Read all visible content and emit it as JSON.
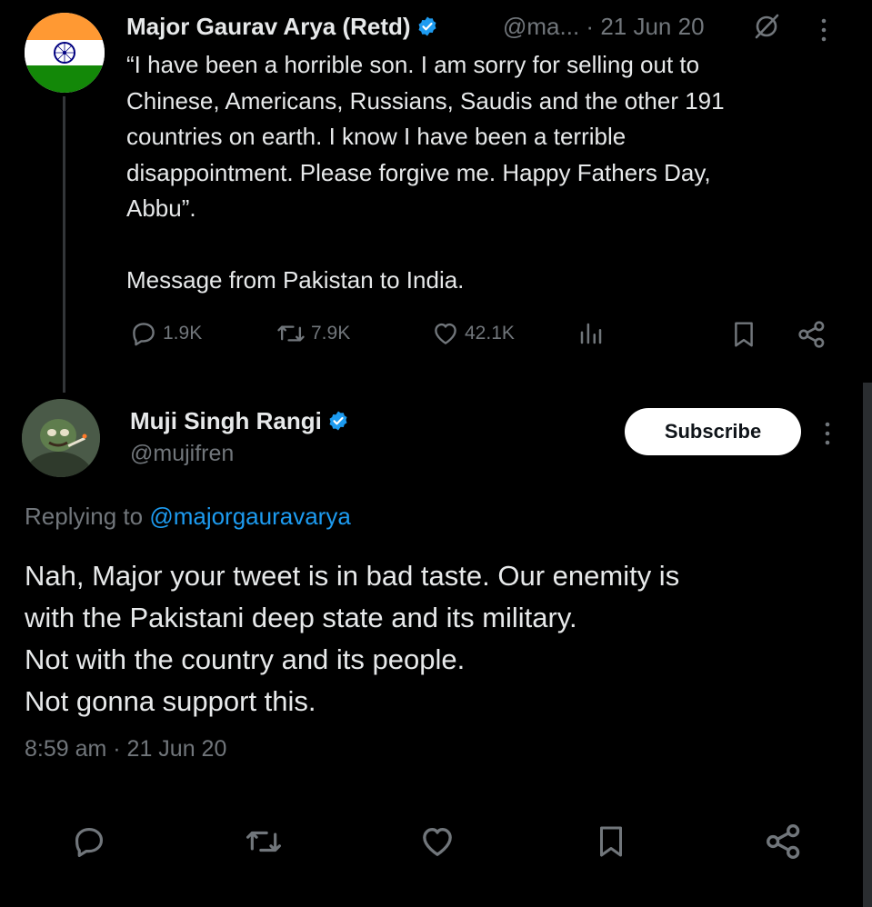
{
  "tweet1": {
    "author_name": "Major Gaurav Arya (Retd)",
    "handle_truncated": "@ma...",
    "separator": "·",
    "date": "21 Jun 20",
    "text": "“I have been a horrible son. I am sorry for selling out to\nChinese, Americans, Russians, Saudis and the other 191\ncountries on earth. I know I have been a terrible\ndisappointment. Please forgive me. Happy Fathers Day,\nAbbu”.\n\nMessage from Pakistan to India.",
    "replies": "1.9K",
    "retweets": "7.9K",
    "likes": "42.1K",
    "avatar_icon": "india-flag-icon"
  },
  "tweet2": {
    "author_name": "Muji Singh Rangi",
    "handle": "@mujifren",
    "subscribe_label": "Subscribe",
    "replying_prefix": "Replying to ",
    "replying_handle": "@majorgauravarya",
    "text": "Nah, Major your tweet is in bad taste. Our enemity is\nwith the Pakistani deep state and its military.\nNot with the country and its people.\nNot gonna support this.",
    "timestamp": "8:59 am · 21 Jun 20"
  },
  "colors": {
    "background": "#000000",
    "text": "#e7e9ea",
    "muted": "#71767b",
    "link": "#1d9bf0",
    "verified": "#1d9bf0"
  }
}
